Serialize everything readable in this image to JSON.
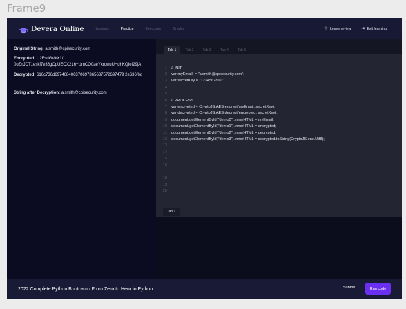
{
  "frame_label": "Frame9",
  "brand": {
    "name": "Devera Online",
    "icon": "graduation-cap-icon"
  },
  "nav": [
    "Lessons",
    "Practice",
    "Exercises",
    "Grades"
  ],
  "header_actions": {
    "leave_review": "Leave review",
    "exit_learning": "Exit learning"
  },
  "left_panel": {
    "original_label": "Original String:",
    "original_value": "alsmith@cpisecurity.com",
    "encrypted_label": "Encrypted:",
    "encrypted_value_1": "U2FsdGVkX1/",
    "encrypted_value_2": "0oZnJDT1eskf7v36gCpUEOX216+UmCO0aeYxrcwuUHdhKQIef29jA",
    "decrypted_label": "Decrypted:",
    "decrypted_value": "616c736d697468406370697365637572697479 2e636f6d",
    "after_label": "String after Decryption:",
    "after_value": "alsmith@cpisecurity.com"
  },
  "editor": {
    "tabs": [
      "Tab 1",
      "Tab 2",
      "Tab 3",
      "Tab 4",
      "Tab 5"
    ],
    "lines": [
      {
        "n": "1",
        "t": "// INIT"
      },
      {
        "n": "2",
        "t": "var myEmail  = \"alsmith@cpisecurity.com\";"
      },
      {
        "n": "3",
        "t": "var secretKey = \"1234567890\";"
      },
      {
        "n": "4",
        "t": ""
      },
      {
        "n": "5",
        "t": ""
      },
      {
        "n": "6",
        "t": "// PROCESS"
      },
      {
        "n": "7",
        "t": "var encrypted = CryptoJS.AES.encrypt(myEmail, secretKey);"
      },
      {
        "n": "8",
        "t": "var decrypted = CryptoJS.AES.decrypt(encrypted, secretKey);"
      },
      {
        "n": "9",
        "t": "document.getElementById(\"demo0\").innerHTML = myEmail;"
      },
      {
        "n": "10",
        "t": "document.getElementById(\"demo1\").innerHTML = encrypted;"
      },
      {
        "n": "11",
        "t": "document.getElementById(\"demo2\").innerHTML = decrypted;"
      },
      {
        "n": "12",
        "t": "document.getElementById(\"demo3\").innerHTML = decrypted.toString(CryptoJS.enc.Utf8);"
      },
      {
        "n": "13",
        "t": ""
      },
      {
        "n": "14",
        "t": ""
      },
      {
        "n": "15",
        "t": ""
      },
      {
        "n": "16",
        "t": ""
      },
      {
        "n": "17",
        "t": ""
      },
      {
        "n": "18",
        "t": ""
      },
      {
        "n": "19",
        "t": ""
      },
      {
        "n": "20",
        "t": ""
      }
    ]
  },
  "output_tab": "Tab 1",
  "footer": {
    "course": "2022 Complete Python Bootcamp From Zero to Hero in Python",
    "submit": "Submit",
    "run": "Run code"
  },
  "colors": {
    "accent": "#6a2ff0",
    "header_bg": "#171935",
    "app_bg": "#0b0c22",
    "editor_bg": "#242532"
  }
}
